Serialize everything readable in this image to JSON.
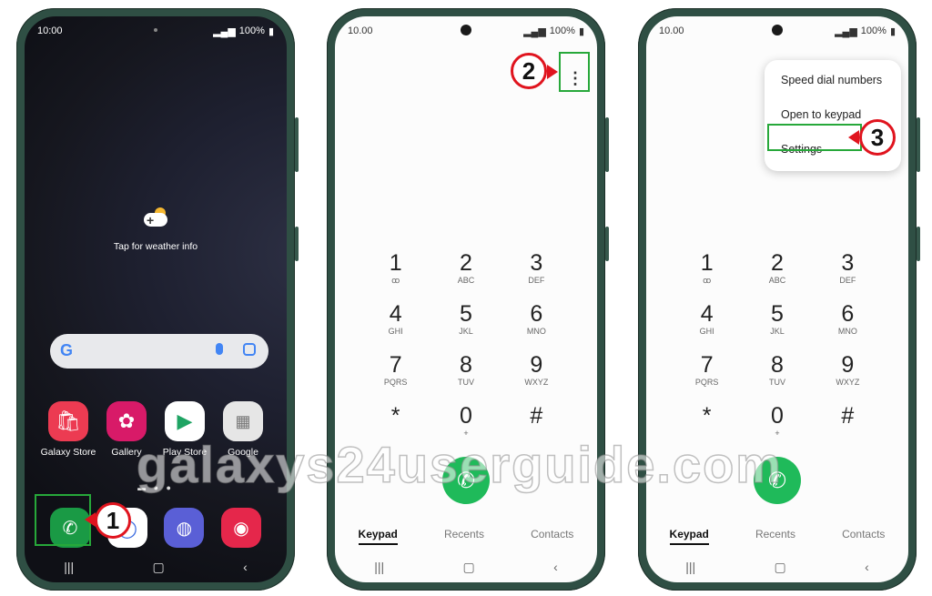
{
  "home": {
    "time": "10:00",
    "battery": "100%",
    "weather_text": "Tap for weather info",
    "apps": [
      {
        "label": "Galaxy Store",
        "icon": "galaxy-store-icon",
        "color": "#ec3b52",
        "glyph": "🛍"
      },
      {
        "label": "Gallery",
        "icon": "gallery-icon",
        "color": "#d81a68",
        "glyph": "✿"
      },
      {
        "label": "Play Store",
        "icon": "play-store-icon",
        "color": "#ffffff",
        "glyph": "▶"
      },
      {
        "label": "Google",
        "icon": "google-folder-icon",
        "color": "#e6e6e6",
        "glyph": "▦"
      }
    ],
    "dock": [
      {
        "icon": "phone-icon",
        "color": "#1a9a45",
        "glyph": "✆"
      },
      {
        "icon": "messages-icon",
        "color": "#ffffff",
        "glyph": "◯"
      },
      {
        "icon": "internet-icon",
        "color": "#5a5fd6",
        "glyph": "◍"
      },
      {
        "icon": "camera-icon",
        "color": "#e5274b",
        "glyph": "◉"
      }
    ],
    "step": "1"
  },
  "dialer": {
    "time": "10.00",
    "battery": "100%",
    "more_glyph": "⋮",
    "keys": [
      {
        "digit": "1",
        "sub": "ꝏ"
      },
      {
        "digit": "2",
        "sub": "ABC"
      },
      {
        "digit": "3",
        "sub": "DEF"
      },
      {
        "digit": "4",
        "sub": "GHI"
      },
      {
        "digit": "5",
        "sub": "JKL"
      },
      {
        "digit": "6",
        "sub": "MNO"
      },
      {
        "digit": "7",
        "sub": "PQRS"
      },
      {
        "digit": "8",
        "sub": "TUV"
      },
      {
        "digit": "9",
        "sub": "WXYZ"
      },
      {
        "digit": "*",
        "sub": ""
      },
      {
        "digit": "0",
        "sub": "+"
      },
      {
        "digit": "#",
        "sub": ""
      }
    ],
    "tabs": [
      "Keypad",
      "Recents",
      "Contacts"
    ],
    "step": "2"
  },
  "menu": {
    "items": [
      "Speed dial numbers",
      "Open to keypad",
      "Settings"
    ],
    "step": "3"
  },
  "watermark": "galaxys24userguide.com",
  "colors": {
    "highlight": "#27a83a",
    "badge_border": "#e0141e",
    "call": "#1fba5a"
  }
}
